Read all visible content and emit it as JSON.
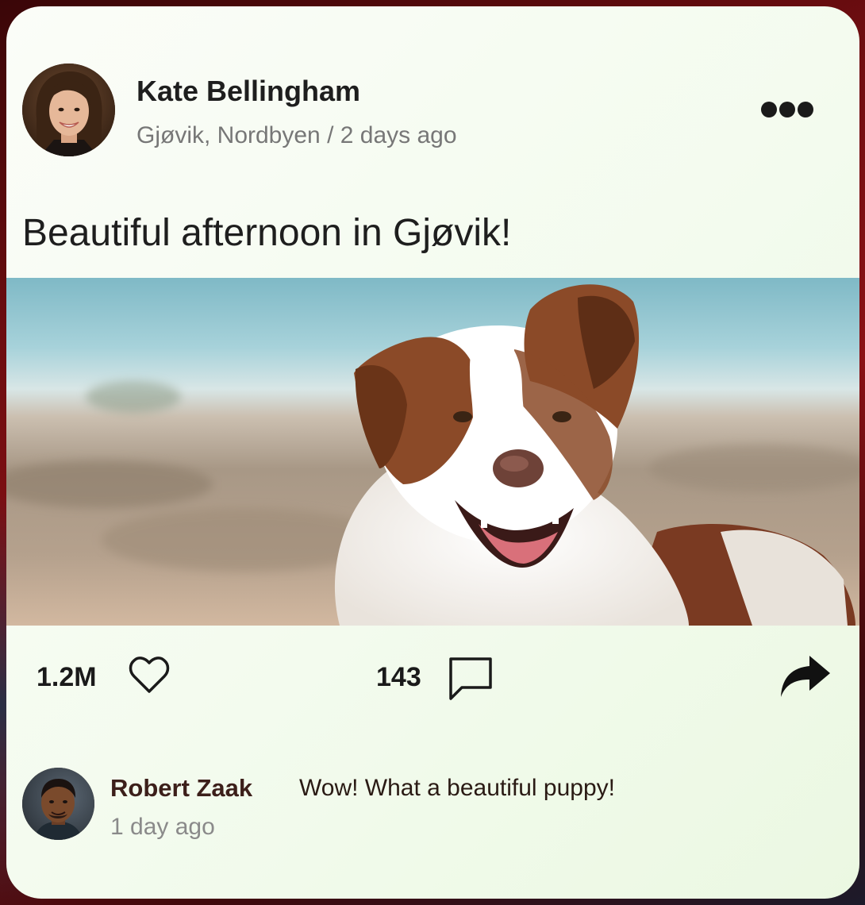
{
  "post": {
    "author_name": "Kate Bellingham",
    "author_meta": "Gjøvik, Nordbyen / 2 days ago",
    "text": "Beautiful afternoon in Gjøvik!",
    "avatar_icon": "woman-portrait",
    "photo_subject": "dog-photo"
  },
  "actions": {
    "likes": "1.2M",
    "comments": "143",
    "like_icon": "heart-outline-icon",
    "comment_icon": "speech-bubble-icon",
    "share_icon": "share-arrow-icon",
    "more_icon": "ellipsis-icon"
  },
  "comment": {
    "author_name": "Robert Zaak",
    "text": "Wow! What a beautiful puppy!",
    "time": "1 day ago",
    "avatar_icon": "man-portrait"
  },
  "colors": {
    "card_bg": "#f3fbee",
    "text_primary": "#1e1e1e",
    "text_muted": "#777777",
    "comment_name": "#3c1f1a",
    "page_bg": "#8a1115"
  }
}
